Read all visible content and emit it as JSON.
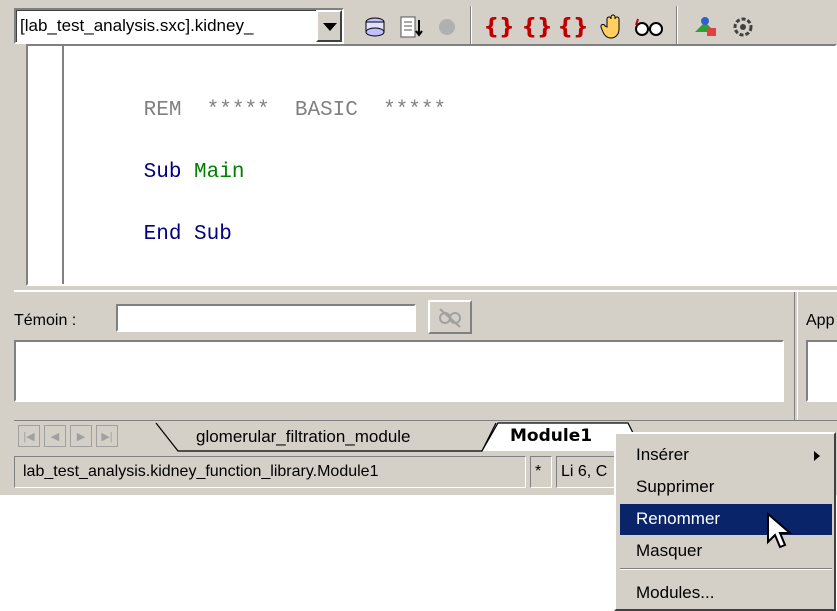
{
  "toolbar": {
    "library_select": "[lab_test_analysis.sxc].kidney_",
    "icons": [
      "library-icon",
      "compile-icon",
      "run-icon",
      "step-into-icon",
      "step-over-icon",
      "step-out-icon",
      "breakpoint-icon",
      "watch-icon",
      "catalog-icon",
      "settings-icon"
    ]
  },
  "editor": {
    "lines": [
      {
        "kw": "REM",
        "rest": "  *****  BASIC  *****"
      },
      {
        "kw": "Sub",
        "ident": "Main"
      },
      {
        "kw": "End Sub"
      }
    ]
  },
  "watch": {
    "label": "Témoin :",
    "input_value": "",
    "calls_label": "App"
  },
  "tabs": {
    "items": [
      "glomerular_filtration_module",
      "Module1"
    ],
    "active": "Module1"
  },
  "status": {
    "path": "lab_test_analysis.kidney_function_library.Module1",
    "modified": "*",
    "position": "Li 6, C"
  },
  "context_menu": {
    "items": [
      {
        "label": "Insérer",
        "submenu": true
      },
      {
        "label": "Supprimer"
      },
      {
        "label": "Renommer",
        "highlighted": true
      },
      {
        "label": "Masquer"
      },
      {
        "label": "Modules..."
      }
    ]
  },
  "colors": {
    "menu_highlight": "#0a246a",
    "keyword": "#000080",
    "identifier": "#008000",
    "comment": "#808080",
    "chrome": "#d4d0c8"
  }
}
